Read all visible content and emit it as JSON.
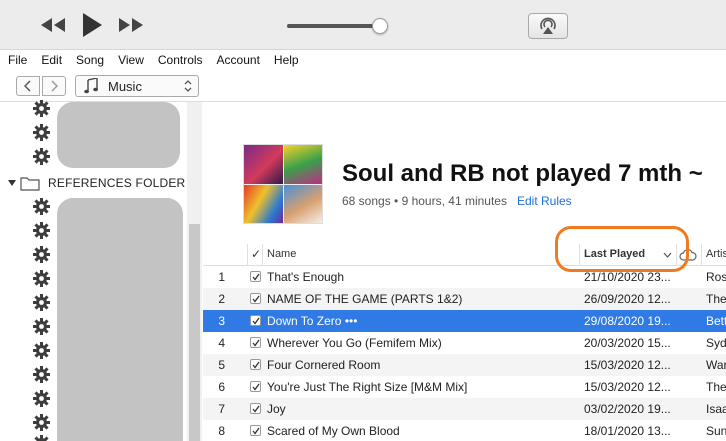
{
  "menu": [
    "File",
    "Edit",
    "Song",
    "View",
    "Controls",
    "Account",
    "Help"
  ],
  "nav": {
    "library_label": "Music"
  },
  "sidebar": {
    "folder_label": "REFERENCES FOLDER"
  },
  "playlist": {
    "title": "Soul and RB not played 7 mth ~",
    "meta": "68 songs • 9 hours, 41 minutes",
    "edit_rules": "Edit Rules"
  },
  "table": {
    "headers": {
      "check": "✓",
      "name": "Name",
      "last_played": "Last Played",
      "artist": "Artis"
    },
    "rows": [
      {
        "num": "1",
        "name": "That's Enough",
        "last_played": "21/10/2020 23...",
        "artist": "Ros"
      },
      {
        "num": "2",
        "name": "NAME OF THE GAME (PARTS 1&2)",
        "last_played": "26/09/2020 12...",
        "artist": "The"
      },
      {
        "num": "3",
        "name": "Down To Zero •••",
        "last_played": "29/08/2020 19...",
        "artist": "Bett"
      },
      {
        "num": "4",
        "name": "Wherever You Go (Femifem Mix)",
        "last_played": "20/03/2020 15...",
        "artist": "Syd"
      },
      {
        "num": "5",
        "name": "Four Cornered Room",
        "last_played": "15/03/2020 12...",
        "artist": "War"
      },
      {
        "num": "6",
        "name": "You're Just The Right Size [M&M Mix]",
        "last_played": "15/03/2020 12...",
        "artist": "The"
      },
      {
        "num": "7",
        "name": "Joy",
        "last_played": "03/02/2020 19...",
        "artist": "Isaa"
      },
      {
        "num": "8",
        "name": "Scared of My Own Blood",
        "last_played": "18/01/2020 13...",
        "artist": "Sun"
      }
    ]
  },
  "colors": {
    "selection": "#2f7ae5",
    "link": "#1f6fd2",
    "annotation": "#ef7a1f"
  }
}
